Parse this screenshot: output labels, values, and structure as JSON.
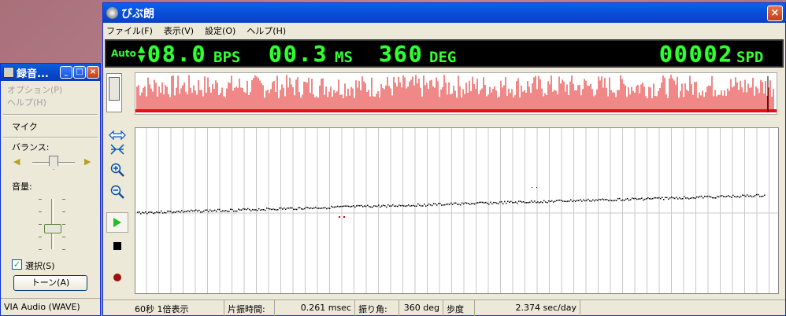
{
  "recorder": {
    "title": "録音...",
    "menu": [
      "オプション(P)",
      "ヘルプ(H)"
    ],
    "source_label": "マイク",
    "balance_label": "バランス:",
    "volume_label": "音量:",
    "select_label": "選択(S)",
    "select_checked": true,
    "tone_button": "トーン(A)",
    "device": "VIA Audio (WAVE)",
    "balance_level": 0.5,
    "volume_level": 0.5
  },
  "main": {
    "title": "びぶ朗",
    "menu": [
      "ファイル(F)",
      "表示(V)",
      "設定(O)",
      "ヘルプ(H)"
    ],
    "led": {
      "mode": "Auto",
      "bps": "08.0",
      "bps_unit": "BPS",
      "ms": "00.3",
      "ms_unit": "MS",
      "deg": "360",
      "deg_unit": "DEG",
      "spd": "00002",
      "spd_unit": "SPD"
    },
    "status": {
      "view": "60秒 1倍表示",
      "half_label": "片振時間:",
      "half_value": "0.261 msec",
      "angle_label": "振り角:",
      "angle_value": "360 deg",
      "rate_label": "歩度",
      "rate_value": "2.374 sec/day"
    }
  },
  "colors": {
    "led_green": "#32ff32",
    "wave_red": "#e01010",
    "titlebar_blue": "#0a4fd6"
  },
  "icons": [
    "width-arrows-icon",
    "fit-icon",
    "zoom-in-icon",
    "zoom-out-icon",
    "play-icon",
    "stop-icon",
    "record-icon"
  ]
}
